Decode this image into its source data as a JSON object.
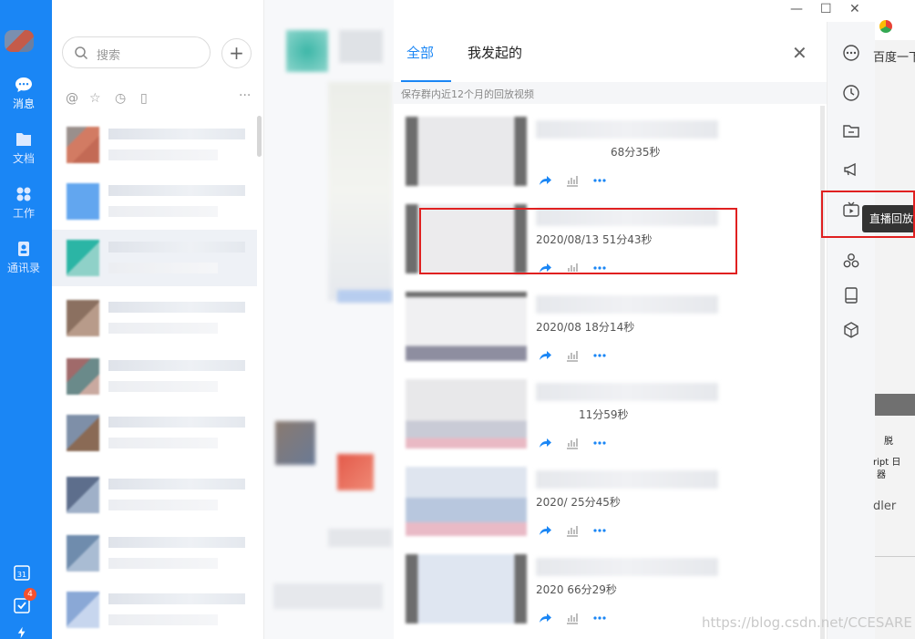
{
  "nav": {
    "items": [
      {
        "label": "消息",
        "icon": "chat-bubble-icon"
      },
      {
        "label": "文档",
        "icon": "docs-folder-icon"
      },
      {
        "label": "工作",
        "icon": "apps-grid-icon"
      },
      {
        "label": "通讯录",
        "icon": "contacts-book-icon"
      }
    ],
    "bottom_badge": "4",
    "calendar_glyph": "31"
  },
  "conversation_list": {
    "search_placeholder": "搜索",
    "add_label": "+",
    "more_label": "···"
  },
  "window": {
    "minimize": "—",
    "maximize": "☐",
    "close": "✕"
  },
  "replay_panel": {
    "tabs": [
      "全部",
      "我发起的"
    ],
    "close_label": "✕",
    "hint": "保存群内近12个月的回放视频",
    "records": [
      {
        "meta": "68分35秒"
      },
      {
        "meta": "2020/08/13 51分43秒"
      },
      {
        "meta": "2020/08 18分14秒"
      },
      {
        "meta": "11分59秒"
      },
      {
        "meta": "2020/ 25分45秒"
      },
      {
        "meta": "2020 66分29秒"
      }
    ]
  },
  "tools": {
    "tooltip": "直播回放"
  },
  "browser": {
    "baidu_text": "百度一下",
    "strip1": "脱",
    "strip2": "ript 日",
    "strip3": "器",
    "dler_text": "dler"
  },
  "watermark": "https://blog.csdn.net/CCESARE",
  "colors": {
    "accent": "#1a86f5",
    "highlight_box": "#e02020",
    "badge": "#f5512e"
  }
}
